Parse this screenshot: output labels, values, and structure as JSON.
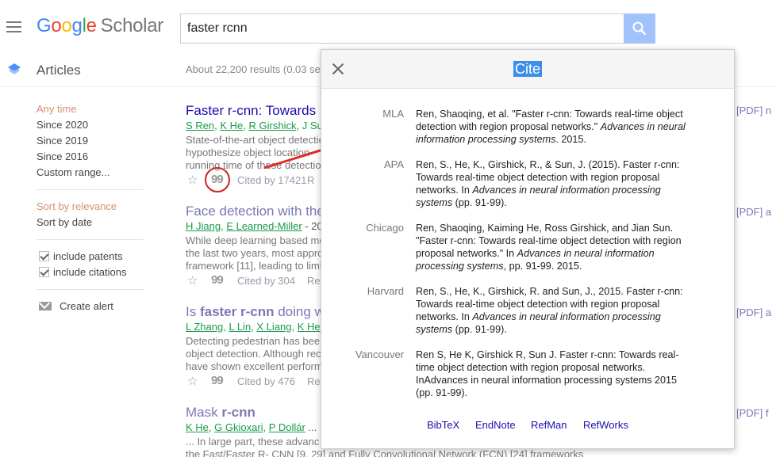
{
  "header": {
    "logo_google": "Google",
    "logo_scholar": "Scholar",
    "search_query": "faster rcnn"
  },
  "sidebar": {
    "section_title": "Articles",
    "time_filters": [
      "Any time",
      "Since 2020",
      "Since 2019",
      "Since 2016",
      "Custom range..."
    ],
    "sort_options": [
      "Sort by relevance",
      "Sort by date"
    ],
    "checkboxes": [
      "include patents",
      "include citations"
    ],
    "create_alert": "Create alert"
  },
  "results": {
    "count_text": "About 22,200 results (0.03 se",
    "items": [
      {
        "title_html_plain": "Faster r-cnn: Towards",
        "authors": [
          "S Ren",
          "K He",
          "R Girshick",
          "J Su"
        ],
        "snippet": [
          "State-of-the-art object detectio",
          "hypothesize object location",
          "running time of these detectio"
        ],
        "cited": "Cited by 17421",
        "related": "R",
        "pdf": "[PDF] n"
      },
      {
        "title": "Face detection with the",
        "authors": [
          "H Jiang",
          "E Learned-Miller"
        ],
        "authors_tail": " - 20",
        "snippet": [
          "While deep learning based me",
          "the last two years, most appro",
          "framework [11], leading to limi"
        ],
        "cited": "Cited by 304",
        "related": "Re",
        "pdf": "[PDF] a"
      },
      {
        "title_pre": "Is ",
        "title_bold": "faster r-cnn",
        "title_post": " doing w",
        "authors": [
          "L Zhang",
          "L Lin",
          "X Liang",
          "K He"
        ],
        "snippet": [
          "Detecting pedestrian has been",
          "object detection. Although rec",
          "have shown excellent perform"
        ],
        "cited": "Cited by 476",
        "related": "Re",
        "pdf": "[PDF] a"
      },
      {
        "title_pre": "Mask ",
        "title_bold": "r-cnn",
        "authors": [
          "K He",
          "G Gkioxari",
          "P Dollár"
        ],
        "authors_tail": " ...",
        "snippet": [
          "... In large part, these advanc",
          "the Fast/Faster R- CNN [9, 29] and Fully Convolutional Network (FCN) [24] frameworks"
        ],
        "pdf": "[PDF] f"
      }
    ]
  },
  "dialog": {
    "title": "Cite",
    "citations": [
      {
        "style": "MLA",
        "lines": [
          {
            "text": "Ren, Shaoqing, et al. \"Faster r-cnn: Towards real-time object"
          },
          {
            "text": "detection with region proposal networks.\" ",
            "italic": "Advances in neural"
          },
          {
            "italic": "information processing systems",
            "text": ". 2015."
          }
        ]
      },
      {
        "style": "APA",
        "lines": [
          {
            "text": "Ren, S., He, K., Girshick, R., & Sun, J. (2015). Faster r-cnn:"
          },
          {
            "text": "Towards real-time object detection with region proposal"
          },
          {
            "text": "networks. In ",
            "italic": "Advances in neural information processing"
          },
          {
            "italic": "systems",
            "text": " (pp. 91-99)."
          }
        ]
      },
      {
        "style": "Chicago",
        "lines": [
          {
            "text": "Ren, Shaoqing, Kaiming He, Ross Girshick, and Jian Sun."
          },
          {
            "text": "\"Faster r-cnn: Towards real-time object detection with region"
          },
          {
            "text": "proposal networks.\" In ",
            "italic": "Advances in neural information"
          },
          {
            "italic": "processing systems",
            "text": ", pp. 91-99. 2015."
          }
        ]
      },
      {
        "style": "Harvard",
        "lines": [
          {
            "text": "Ren, S., He, K., Girshick, R. and Sun, J., 2015. Faster r-cnn:"
          },
          {
            "text": "Towards real-time object detection with region proposal"
          },
          {
            "text": "networks. In ",
            "italic": "Advances in neural information processing"
          },
          {
            "italic": "systems",
            "text": " (pp. 91-99)."
          }
        ]
      },
      {
        "style": "Vancouver",
        "lines": [
          {
            "text": "Ren S, He K, Girshick R, Sun J. Faster r-cnn: Towards real-"
          },
          {
            "text": "time object detection with region proposal networks."
          },
          {
            "text": "InAdvances in neural information processing systems 2015"
          },
          {
            "text": "(pp. 91-99)."
          }
        ]
      }
    ],
    "exports": [
      "BibTeX",
      "EndNote",
      "RefMan",
      "RefWorks"
    ]
  },
  "colors": {
    "accent_blue": "#4285f4",
    "search_button": "#a1c2fa",
    "link": "#1a0dab",
    "author_green": "#1a9a4a",
    "annotation_red": "#d32020",
    "title_highlight": "#3b8fea"
  }
}
